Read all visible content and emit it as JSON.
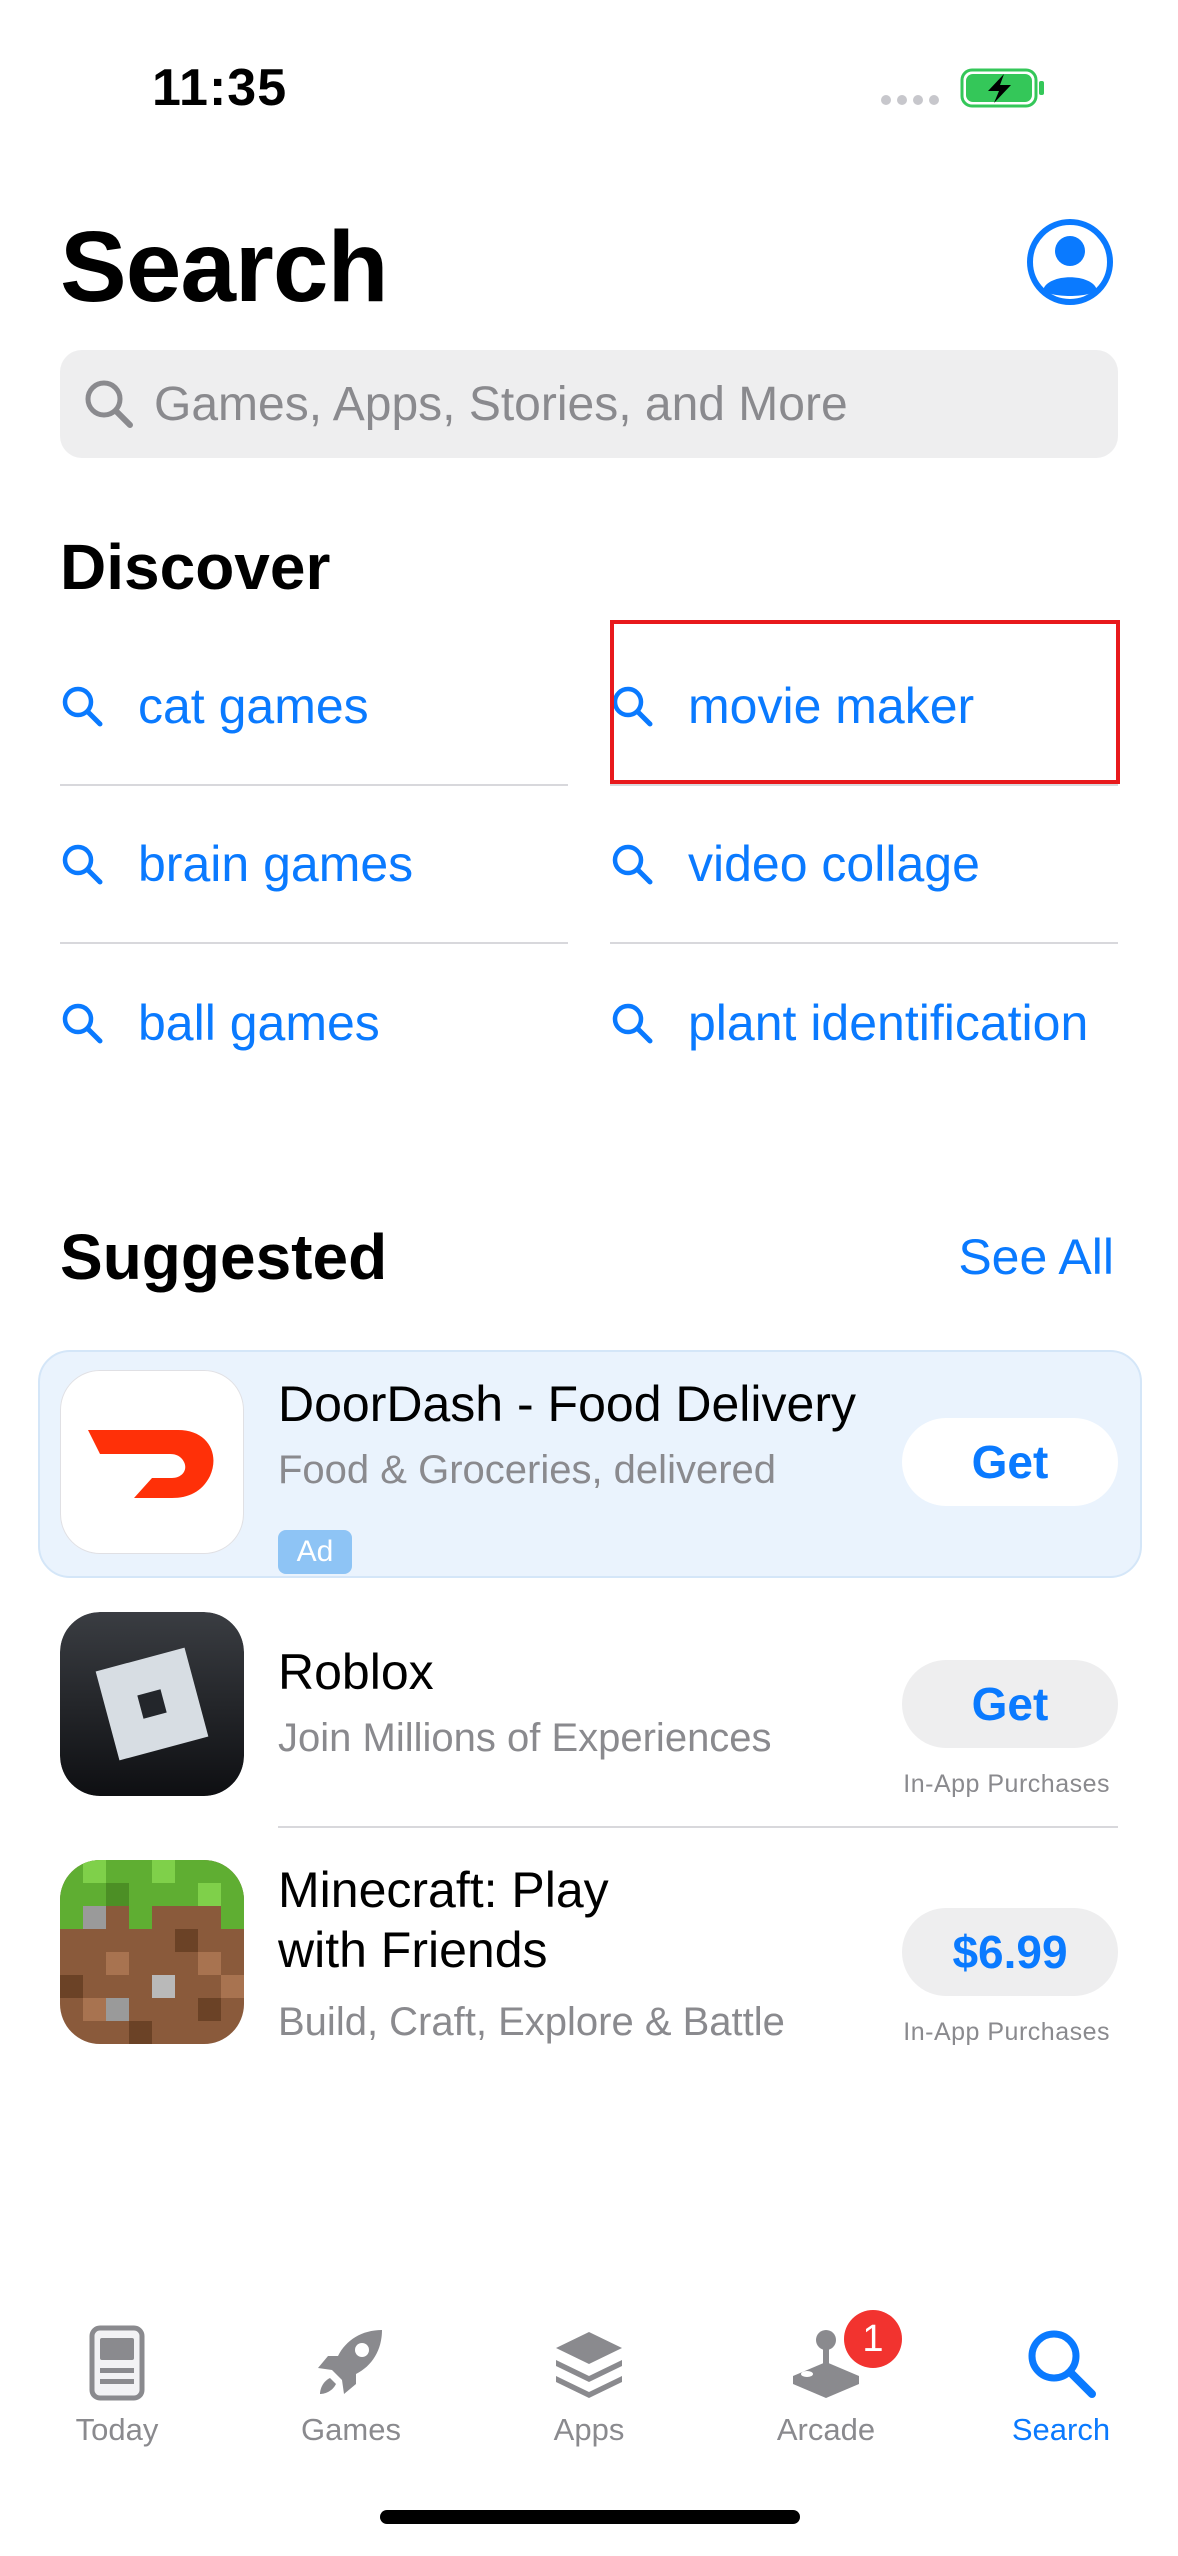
{
  "status_bar": {
    "time": "11:35"
  },
  "header": {
    "title": "Search"
  },
  "search": {
    "placeholder": "Games, Apps, Stories, and More"
  },
  "discover": {
    "title": "Discover",
    "items": [
      {
        "label": "cat games"
      },
      {
        "label": "movie maker"
      },
      {
        "label": "brain games"
      },
      {
        "label": "video collage"
      },
      {
        "label": "ball games"
      },
      {
        "label": "plant identification"
      }
    ]
  },
  "suggested": {
    "title": "Suggested",
    "see_all": "See All",
    "apps": [
      {
        "name": "DoorDash - Food Delivery",
        "subtitle": "Food & Groceries, delivered",
        "badge": "Ad",
        "button": "Get",
        "note": ""
      },
      {
        "name": "Roblox",
        "subtitle": "Join Millions of Experiences",
        "button": "Get",
        "note": "In-App Purchases"
      },
      {
        "name_line1": "Minecraft: Play",
        "name_line2": "with Friends",
        "subtitle": "Build, Craft, Explore & Battle",
        "button": "$6.99",
        "note": "In-App Purchases"
      }
    ]
  },
  "tab_bar": {
    "tabs": [
      {
        "label": "Today",
        "icon": "today-icon"
      },
      {
        "label": "Games",
        "icon": "rocket-icon"
      },
      {
        "label": "Apps",
        "icon": "apps-stack-icon"
      },
      {
        "label": "Arcade",
        "icon": "joystick-icon",
        "badge": "1"
      },
      {
        "label": "Search",
        "icon": "search-icon",
        "active": true
      }
    ]
  },
  "colors": {
    "accent": "#0a7aff",
    "badge": "#f2332f",
    "doordash": "#ff3008",
    "highlight": "#e8191c"
  }
}
